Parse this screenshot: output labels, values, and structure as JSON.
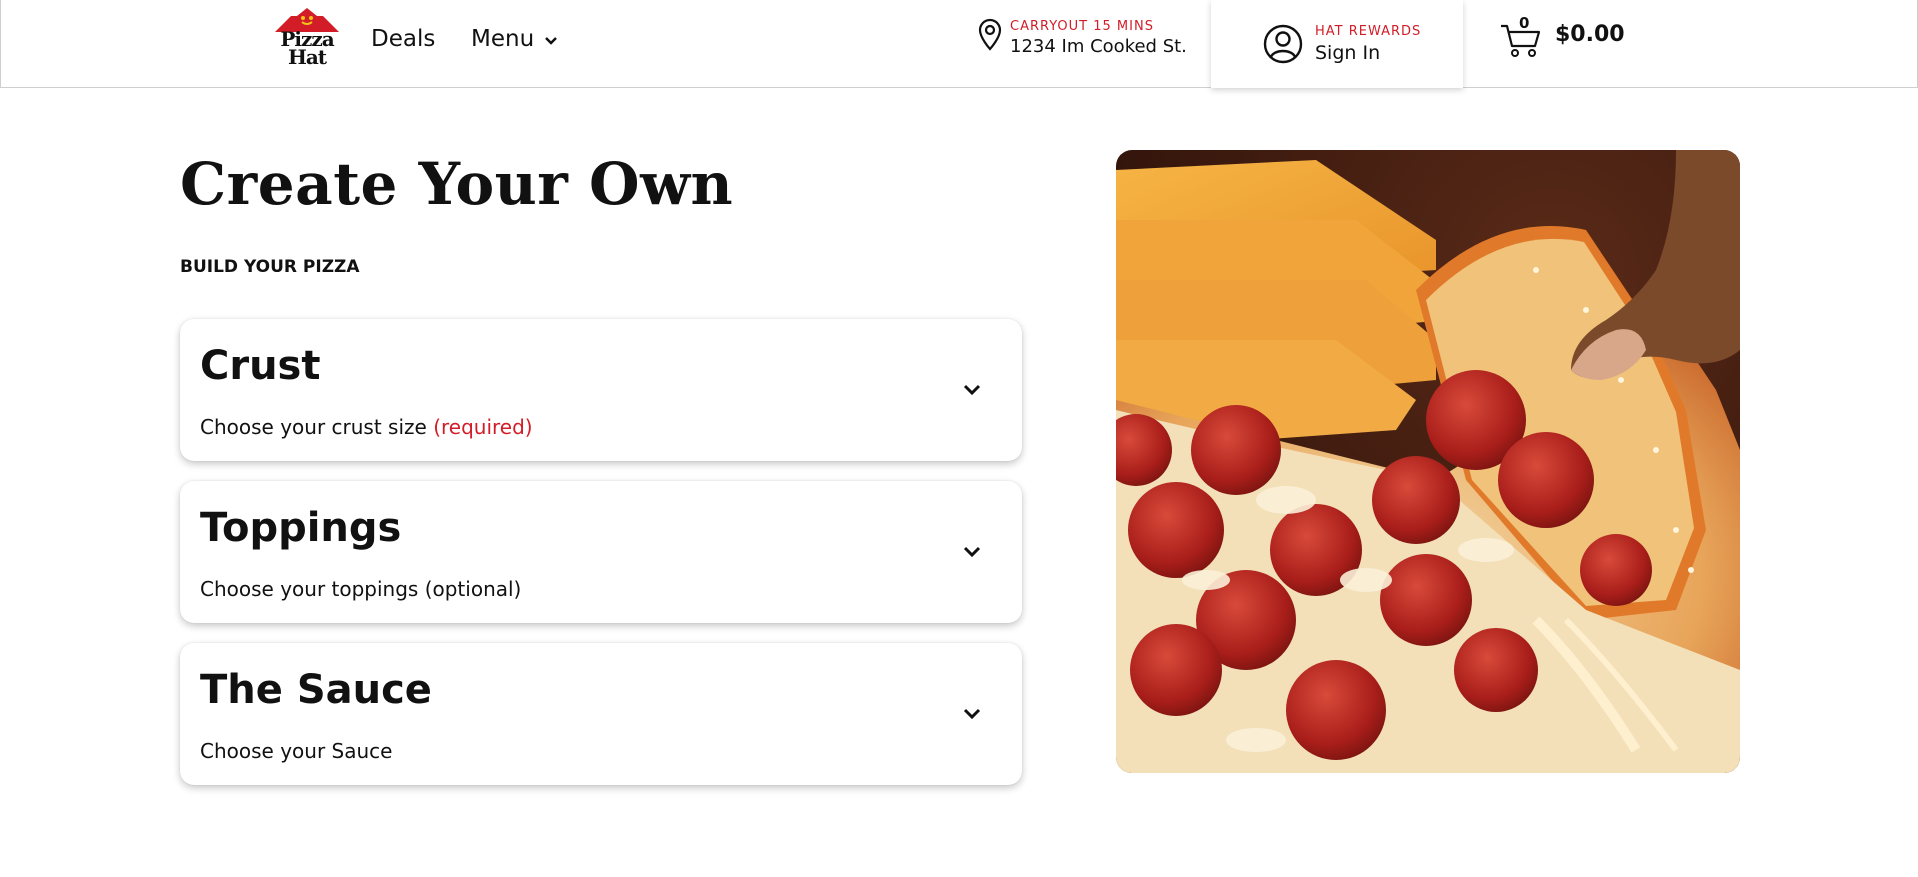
{
  "header": {
    "logo_text": "Pizza Hat",
    "nav": {
      "deals": "Deals",
      "menu": "Menu"
    },
    "location": {
      "mode": "CARRYOUT 15 MINS",
      "address": "1234 Im Cooked St."
    },
    "rewards": {
      "label": "HAT REWARDS",
      "sign_in": "Sign In"
    },
    "cart": {
      "count": "0",
      "total": "$0.00"
    }
  },
  "main": {
    "title": "Create Your Own",
    "subtitle": "BUILD YOUR PIZZA",
    "sections": [
      {
        "title": "Crust",
        "desc": "Choose your crust size",
        "required": "(required)"
      },
      {
        "title": "Toppings",
        "desc": "Choose your toppings (optional)"
      },
      {
        "title": "The Sauce",
        "desc": "Choose your Sauce"
      }
    ],
    "hero_image": "pepperoni-pizza-photo"
  },
  "colors": {
    "accent_red": "#d21d28",
    "text": "#111111"
  }
}
